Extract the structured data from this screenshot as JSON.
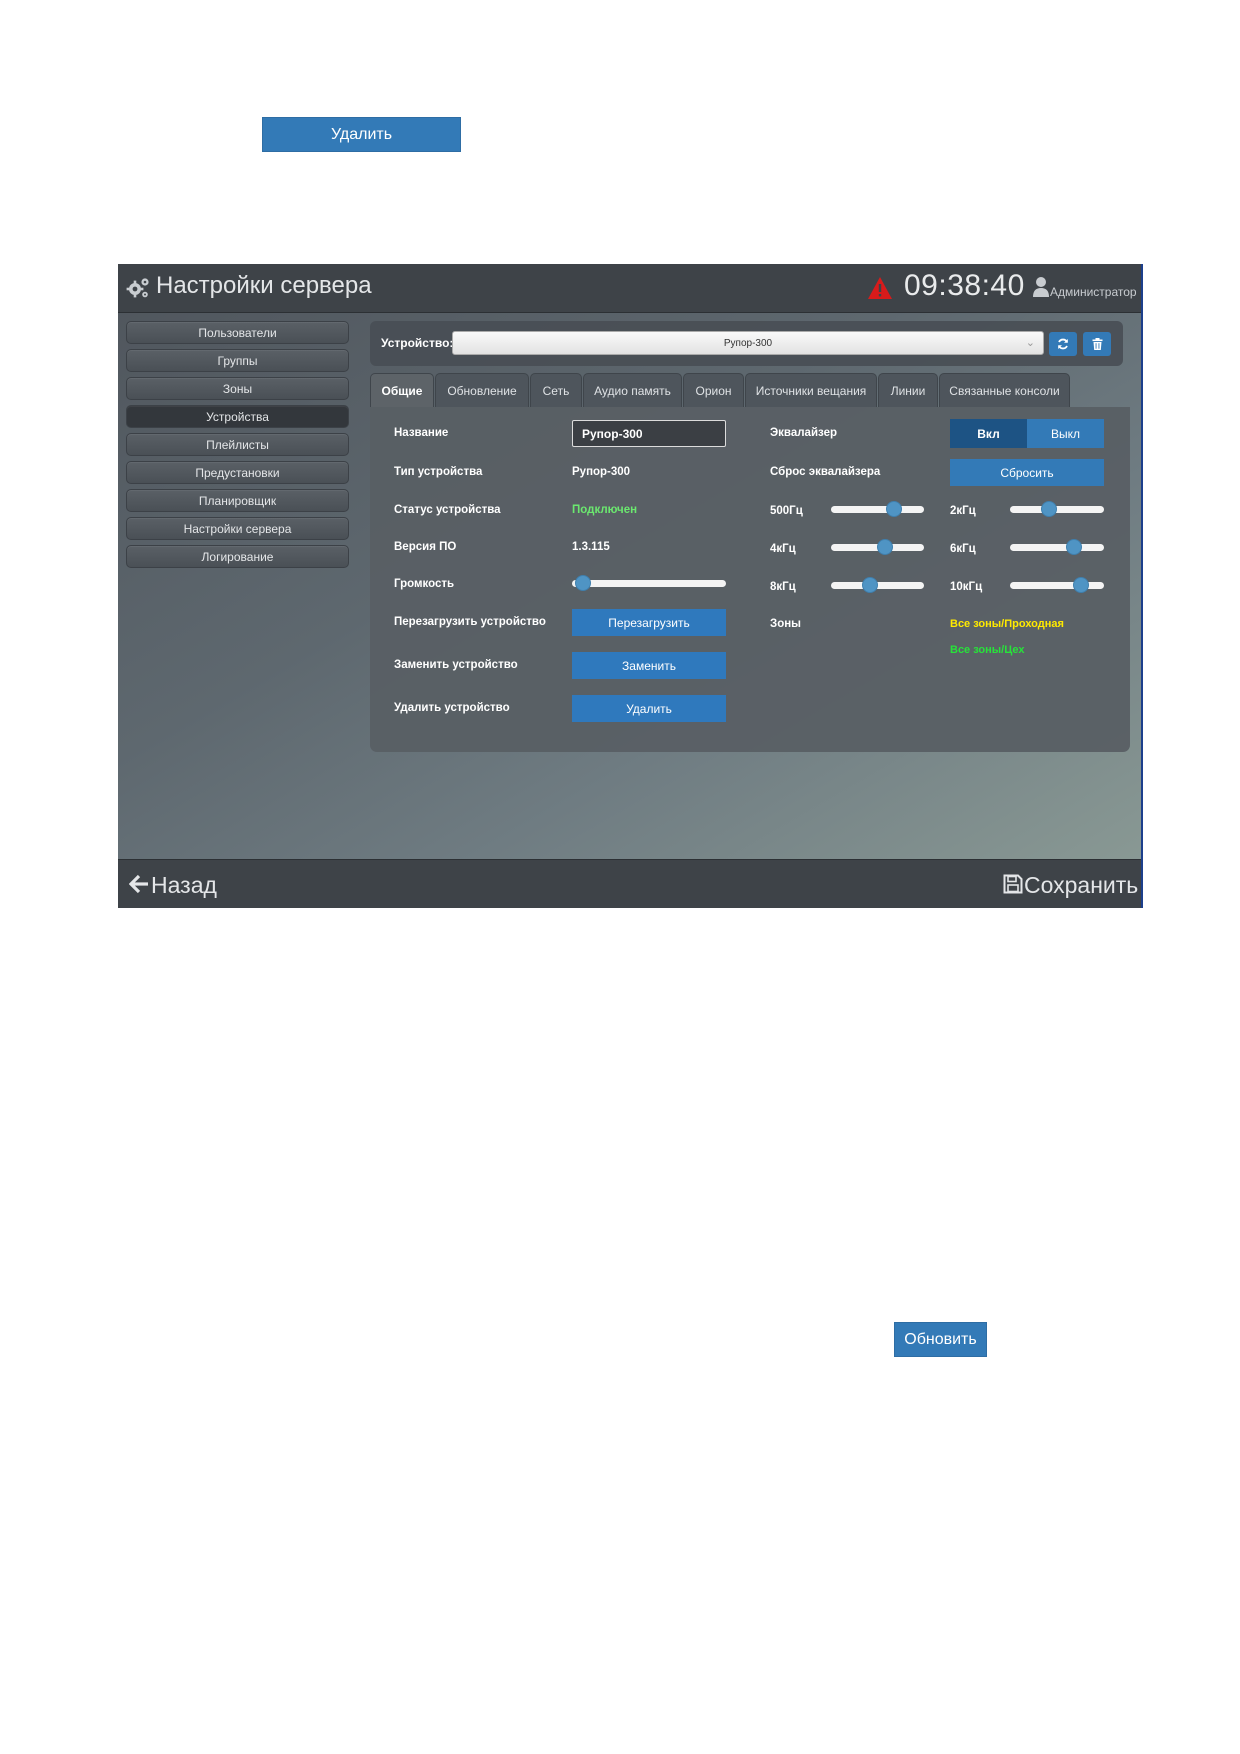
{
  "document": {
    "delete_button": "Удалить",
    "refresh_button": "Обновить"
  },
  "header": {
    "title": "Настройки сервера",
    "time": "09:38:40",
    "user": "Администратор",
    "icons": [
      "gear-icon",
      "warning-icon",
      "user-icon"
    ]
  },
  "sidebar": {
    "items": [
      {
        "label": "Пользователи",
        "active": false
      },
      {
        "label": "Группы",
        "active": false
      },
      {
        "label": "Зоны",
        "active": false
      },
      {
        "label": "Устройства",
        "active": true
      },
      {
        "label": "Плейлисты",
        "active": false
      },
      {
        "label": "Предустановки",
        "active": false
      },
      {
        "label": "Планировщик",
        "active": false
      },
      {
        "label": "Настройки сервера",
        "active": false
      },
      {
        "label": "Логирование",
        "active": false
      }
    ]
  },
  "device_bar": {
    "label": "Устройство:",
    "selected": "Рупор-300",
    "icons": [
      "sync-icon",
      "trash-icon"
    ]
  },
  "tabs": [
    {
      "label": "Общие",
      "active": true
    },
    {
      "label": "Обновление",
      "active": false
    },
    {
      "label": "Сеть",
      "active": false
    },
    {
      "label": "Аудио память",
      "active": false
    },
    {
      "label": "Орион",
      "active": false
    },
    {
      "label": "Источники вещания",
      "active": false
    },
    {
      "label": "Линии",
      "active": false
    },
    {
      "label": "Связанные консоли",
      "active": false
    }
  ],
  "general": {
    "name_label": "Название",
    "name_value": "Рупор-300",
    "type_label": "Тип устройства",
    "type_value": "Рупор-300",
    "status_label": "Статус устройства",
    "status_value": "Подключен",
    "firmware_label": "Версия ПО",
    "firmware_value": "1.3.115",
    "volume_label": "Громкость",
    "volume_level": 0.07,
    "reboot_label": "Перезагрузить устройство",
    "reboot_button": "Перезагрузить",
    "replace_label": "Заменить устройство",
    "replace_button": "Заменить",
    "delete_label": "Удалить устройство",
    "delete_button": "Удалить"
  },
  "equalizer": {
    "label": "Эквалайзер",
    "on_label": "Вкл",
    "off_label": "Выкл",
    "state": "on",
    "reset_label": "Сброс эквалайзера",
    "reset_button": "Сбросить",
    "bands": [
      {
        "label": "500Гц",
        "level": 0.68
      },
      {
        "label": "2кГц",
        "level": 0.42
      },
      {
        "label": "4кГц",
        "level": 0.58
      },
      {
        "label": "6кГц",
        "level": 0.68
      },
      {
        "label": "8кГц",
        "level": 0.42
      },
      {
        "label": "10кГц",
        "level": 0.75
      }
    ]
  },
  "zones": {
    "label": "Зоны",
    "items": [
      {
        "label": "Все зоны/Проходная",
        "color": "#ffea00"
      },
      {
        "label": "Все зоны/Цех",
        "color": "#27e23a"
      }
    ]
  },
  "footer": {
    "back_label": "Назад",
    "save_label": "Сохранить",
    "icons": [
      "arrow-left-icon",
      "floppy-disk-icon"
    ]
  },
  "colors": {
    "accent": "#337ab7",
    "status_ok": "#6be86f",
    "eq_on": "#1d5384"
  }
}
